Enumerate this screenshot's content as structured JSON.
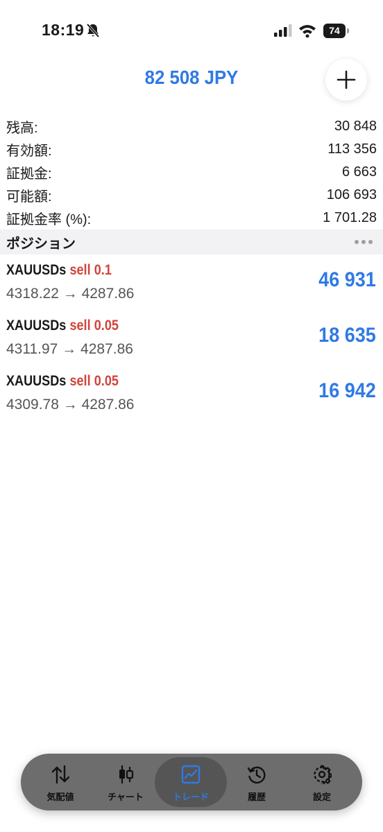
{
  "status_bar": {
    "time": "18:19",
    "battery": "74"
  },
  "header": {
    "title": "82 508 JPY"
  },
  "summary": [
    {
      "label": "残高:",
      "value": "30 848"
    },
    {
      "label": "有効額:",
      "value": "113 356"
    },
    {
      "label": "証拠金:",
      "value": "6 663"
    },
    {
      "label": "可能額:",
      "value": "106 693"
    },
    {
      "label": "証拠金率 (%):",
      "value": "1 701.28"
    }
  ],
  "positions_section": {
    "title": "ポジション"
  },
  "positions": [
    {
      "symbol": "XAUUSDs",
      "side": "sell",
      "volume": "0.1",
      "prices": "4318.22 → 4287.86",
      "profit": "46 931"
    },
    {
      "symbol": "XAUUSDs",
      "side": "sell",
      "volume": "0.05",
      "prices": "4311.97 → 4287.86",
      "profit": "18 635"
    },
    {
      "symbol": "XAUUSDs",
      "side": "sell",
      "volume": "0.05",
      "prices": "4309.78 → 4287.86",
      "profit": "16 942"
    }
  ],
  "tabs": [
    {
      "label": "気配値",
      "icon": "arrows-up-down-icon",
      "active": false
    },
    {
      "label": "チャート",
      "icon": "candlestick-icon",
      "active": false
    },
    {
      "label": "トレード",
      "icon": "trade-chart-icon",
      "active": true
    },
    {
      "label": "履歴",
      "icon": "history-icon",
      "active": false
    },
    {
      "label": "設定",
      "icon": "gear-icon",
      "active": false
    }
  ],
  "colors": {
    "accent": "#2f7ae5",
    "sell": "#d2433a",
    "tab_bar": "#6d6d6d"
  }
}
